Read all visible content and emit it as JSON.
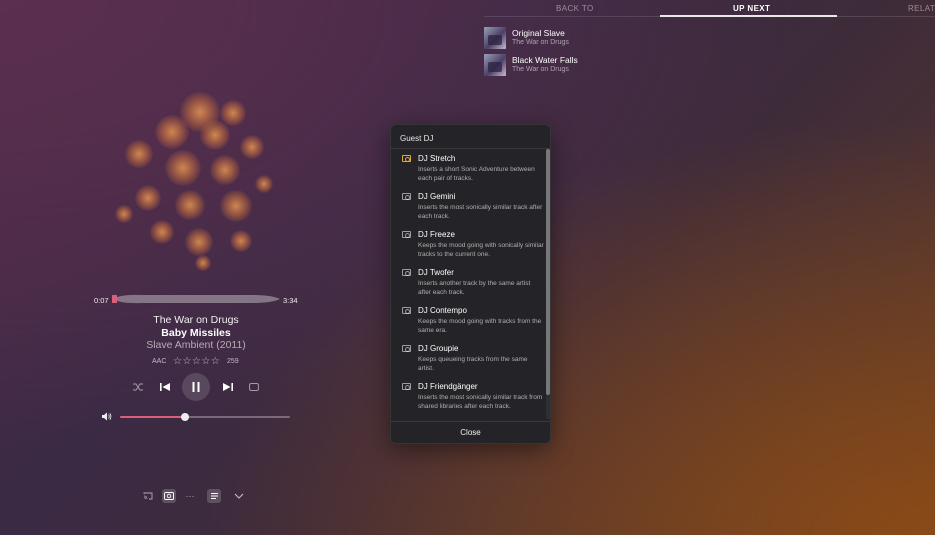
{
  "tabs": [
    {
      "label": "BACK TO",
      "active": false
    },
    {
      "label": "UP NEXT",
      "active": true
    },
    {
      "label": "RELATE",
      "active": false
    }
  ],
  "queue": [
    {
      "title": "Original Slave",
      "artist": "The War on Drugs"
    },
    {
      "title": "Black Water Falls",
      "artist": "The War on Drugs"
    }
  ],
  "player": {
    "elapsed": "0:07",
    "duration": "3:34",
    "progress_fraction": 0.03,
    "artist": "The War on Drugs",
    "song": "Baby Missiles",
    "album": "Slave Ambient (2011)",
    "format": "AAC",
    "rating_stars": "☆☆☆☆☆",
    "rating": 0,
    "play_count": "259",
    "volume_fraction": 0.38,
    "accent_color": "#d8607c"
  },
  "icons": {
    "shuffle": "shuffle-icon",
    "previous": "previous-icon",
    "pause": "pause-icon",
    "next": "next-icon",
    "repeat": "repeat-icon",
    "volume": "speaker-icon",
    "cast": "cast-icon",
    "dj": "dj-icon",
    "more": "ellipsis-icon",
    "queue": "queue-icon",
    "collapse": "chevron-down-icon"
  },
  "dialog": {
    "title": "Guest DJ",
    "close_label": "Close",
    "active_color": "#e5a93c",
    "items": [
      {
        "name": "DJ Stretch",
        "desc": "Inserts a short Sonic Adventure between each pair of tracks.",
        "active": true
      },
      {
        "name": "DJ Gemini",
        "desc": "Inserts the most sonically similar track after each track.",
        "active": false
      },
      {
        "name": "DJ Freeze",
        "desc": "Keeps the mood going with sonically similar tracks to the current one.",
        "active": false
      },
      {
        "name": "DJ Twofer",
        "desc": "Inserts another track by the same artist after each track.",
        "active": false
      },
      {
        "name": "DJ Contempo",
        "desc": "Keeps the mood going with tracks from the same era.",
        "active": false
      },
      {
        "name": "DJ Groupie",
        "desc": "Keeps queueing tracks from the same artist.",
        "active": false
      },
      {
        "name": "DJ Friendgänger",
        "desc": "Inserts the most sonically similar track from shared libraries after each track.",
        "active": false
      }
    ]
  }
}
